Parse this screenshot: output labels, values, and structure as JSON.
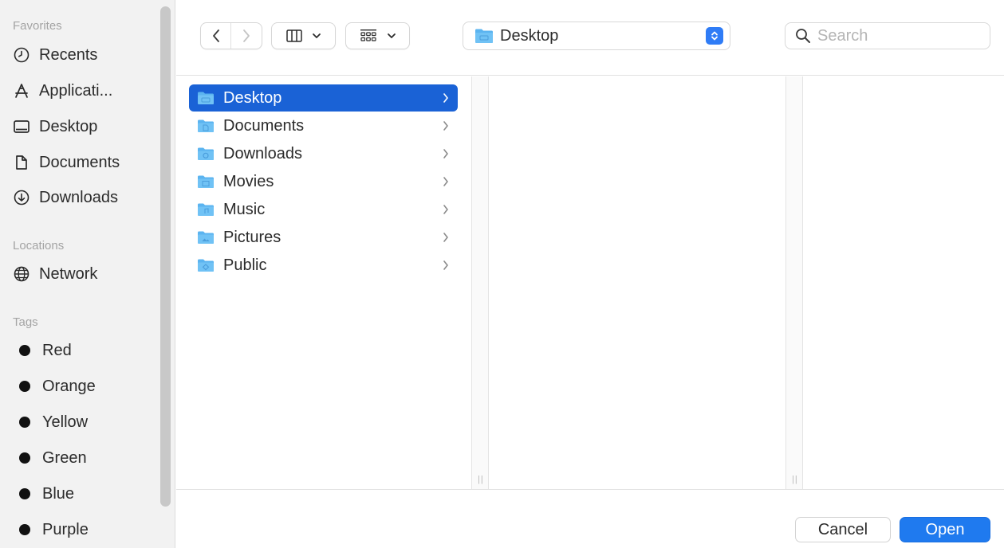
{
  "sidebar": {
    "favorites_heading": "Favorites",
    "favorites": [
      {
        "label": "Recents",
        "icon": "clock-icon"
      },
      {
        "label": "Applicati...",
        "icon": "applications-icon"
      },
      {
        "label": "Desktop",
        "icon": "desktop-icon"
      },
      {
        "label": "Documents",
        "icon": "document-icon"
      },
      {
        "label": "Downloads",
        "icon": "download-icon"
      }
    ],
    "locations_heading": "Locations",
    "locations": [
      {
        "label": "Network",
        "icon": "globe-icon"
      }
    ],
    "tags_heading": "Tags",
    "tags": [
      {
        "label": "Red"
      },
      {
        "label": "Orange"
      },
      {
        "label": "Yellow"
      },
      {
        "label": "Green"
      },
      {
        "label": "Blue"
      },
      {
        "label": "Purple"
      }
    ]
  },
  "toolbar": {
    "back_icon": "chevron-left-icon",
    "forward_icon": "chevron-right-icon",
    "view_mode_icon": "columns-view-icon",
    "group_icon": "grid-icon",
    "path_popup_label": "Desktop",
    "search_placeholder": "Search"
  },
  "browser": {
    "column1": [
      {
        "label": "Desktop",
        "selected": true
      },
      {
        "label": "Documents",
        "selected": false
      },
      {
        "label": "Downloads",
        "selected": false
      },
      {
        "label": "Movies",
        "selected": false
      },
      {
        "label": "Music",
        "selected": false
      },
      {
        "label": "Pictures",
        "selected": false
      },
      {
        "label": "Public",
        "selected": false
      }
    ]
  },
  "footer": {
    "cancel_label": "Cancel",
    "open_label": "Open"
  },
  "colors": {
    "accent": "#1f7aef",
    "selection": "#1a62d6",
    "folder": "#5bb4f0",
    "sidebar_bg": "#f2f2f2"
  }
}
